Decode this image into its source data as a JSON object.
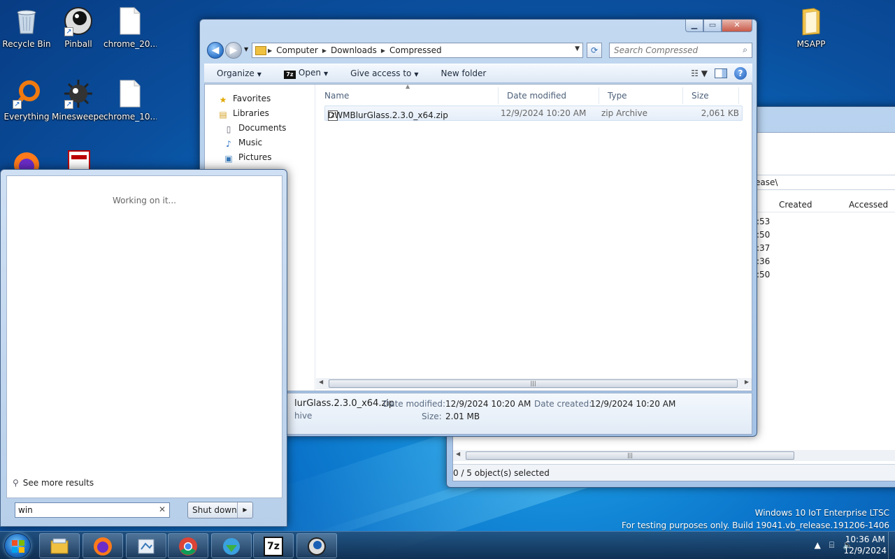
{
  "desktop": {
    "icons": [
      {
        "label": "Recycle Bin",
        "icon": "recycle-bin-icon"
      },
      {
        "label": "Pinball",
        "icon": "pinball-icon"
      },
      {
        "label": "chrome_20...",
        "icon": "file-icon"
      },
      {
        "label": "Everything",
        "icon": "everything-search-icon"
      },
      {
        "label": "Minesweeper",
        "icon": "minesweeper-icon"
      },
      {
        "label": "chrome_10...",
        "icon": "file-icon"
      },
      {
        "label": "MSAPP",
        "icon": "folder-icon"
      }
    ]
  },
  "bg_window": {
    "path_fragment": "ease\\",
    "columns": [
      "Created",
      "Accessed"
    ],
    "rows": [
      ":53",
      ":50",
      ":37",
      ":36",
      ":50"
    ],
    "status": "0 / 5 object(s) selected"
  },
  "explorer": {
    "breadcrumb": [
      "Computer",
      "Downloads",
      "Compressed"
    ],
    "search_placeholder": "Search Compressed",
    "toolbar": {
      "organize": "Organize",
      "open": "Open",
      "give_access": "Give access to",
      "new_folder": "New folder"
    },
    "nav": [
      {
        "label": "Favorites",
        "icon": "star-icon"
      },
      {
        "label": "Libraries",
        "icon": "libraries-icon"
      },
      {
        "label": "Documents",
        "icon": "documents-icon"
      },
      {
        "label": "Music",
        "icon": "music-icon"
      },
      {
        "label": "Pictures",
        "icon": "pictures-icon"
      }
    ],
    "columns": {
      "name": "Name",
      "date": "Date modified",
      "type": "Type",
      "size": "Size"
    },
    "files": [
      {
        "name": "DWMBlurGlass.2.3.0_x64.zip",
        "date": "12/9/2024 10:20 AM",
        "type": "zip Archive",
        "size": "2,061 KB"
      }
    ],
    "details": {
      "name": "lurGlass.2.3.0_x64.zip",
      "type": "hive",
      "date_modified_label": "Date modified:",
      "date_modified": "12/9/2024 10:20 AM",
      "date_created_label": "Date created:",
      "date_created": "12/9/2024 10:20 AM",
      "size_label": "Size:",
      "size": "2.01 MB"
    }
  },
  "start_menu": {
    "status": "Working on it...",
    "see_more": "See more results",
    "search_value": "win",
    "shutdown": "Shut down"
  },
  "watermark": {
    "line1": "Windows 10 IoT Enterprise LTSC",
    "line2": "For testing purposes only. Build 19041.vb_release.191206-1406"
  },
  "taskbar": {
    "apps": [
      "explorer-icon",
      "firefox-icon",
      "paint-icon",
      "chrome-icon",
      "download-manager-icon",
      "7zip-icon",
      "pinball-icon"
    ],
    "time": "10:36 AM",
    "date": "12/9/2024",
    "tray_icons": [
      "show-hidden-icons-icon",
      "network-icon",
      "volume-icon"
    ],
    "taskbar_7z_label": "7z"
  },
  "colors": {
    "accent": "#1d5cb8",
    "desktop": "#0a72c9"
  }
}
